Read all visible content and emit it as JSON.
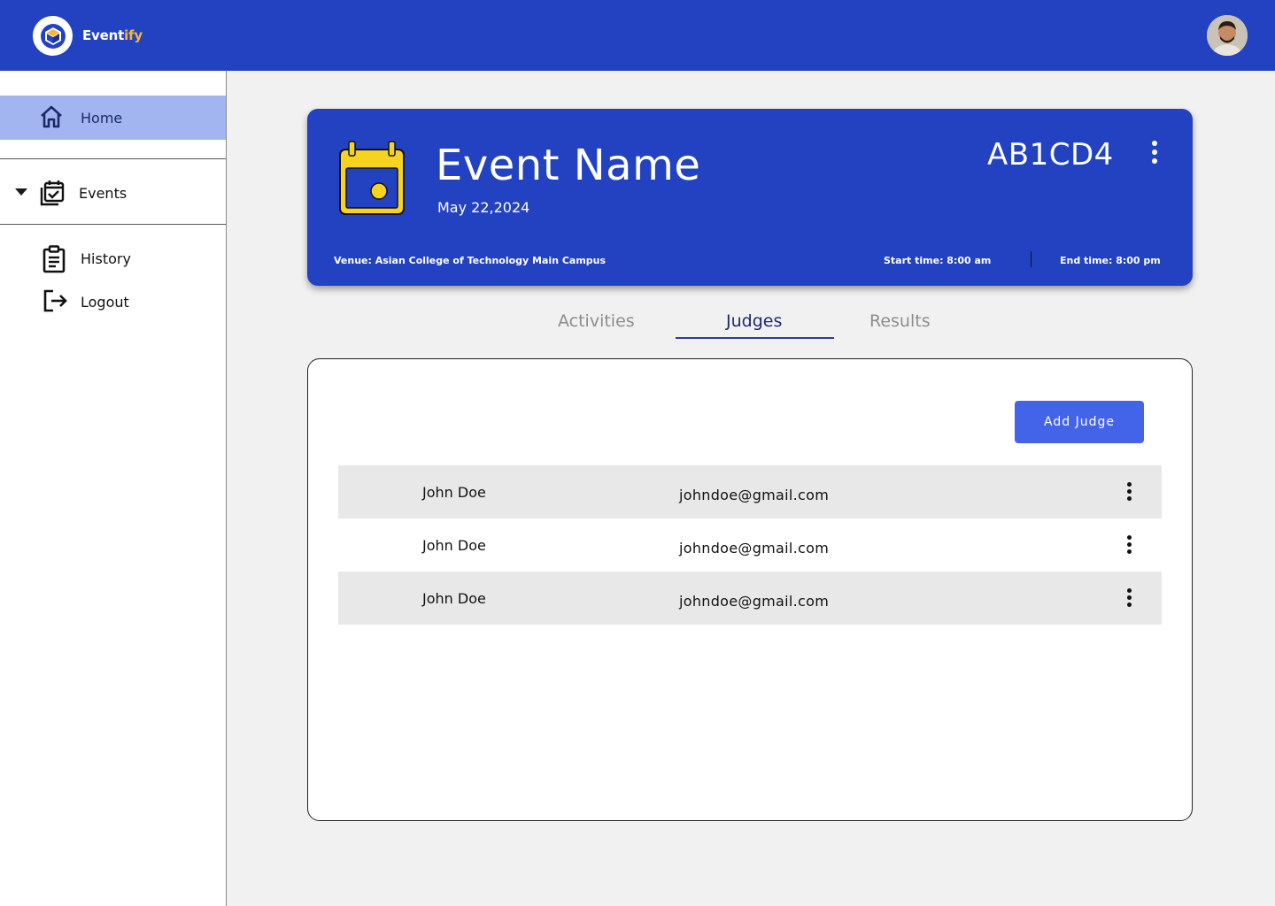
{
  "app": {
    "brand_main": "Event",
    "brand_accent": "ify"
  },
  "sidebar": {
    "home": "Home",
    "events": "Events",
    "history": "History",
    "logout": "Logout"
  },
  "event": {
    "name": "Event Name",
    "date": "May 22,2024",
    "code": "AB1CD4",
    "venue": "Venue: Asian College of Technology Main Campus",
    "start_time": "Start time: 8:00 am",
    "end_time": "End time: 8:00 pm"
  },
  "tabs": [
    {
      "label": "Activities",
      "active": false
    },
    {
      "label": "Judges",
      "active": true
    },
    {
      "label": "Results",
      "active": false
    }
  ],
  "judges": {
    "add_label": "Add Judge",
    "rows": [
      {
        "name": "John Doe",
        "email": "johndoe@gmail.com"
      },
      {
        "name": "John Doe",
        "email": "johndoe@gmail.com"
      },
      {
        "name": "John Doe",
        "email": "johndoe@gmail.com"
      }
    ]
  },
  "colors": {
    "primary": "#2342c2",
    "accent": "#f5b82e",
    "button": "#4364e9",
    "nav_active": "#a3b5f1"
  }
}
